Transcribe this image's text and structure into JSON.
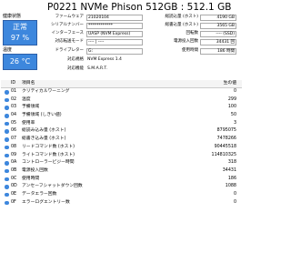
{
  "title": "P0221 NVMe Phison 512GB : 512.1 GB",
  "status": {
    "health_label": "健康状態",
    "health_value": "正常",
    "health_percent": "97 %",
    "temp_label": "温度",
    "temp_value": "26 °C"
  },
  "left_info": [
    {
      "label": "ファームウェア",
      "value": "21020104"
    },
    {
      "label": "シリアルナンバー",
      "value": "************"
    },
    {
      "label": "インターフェース",
      "value": "UASP (NVM Express)"
    },
    {
      "label": "対応転送モード",
      "value": "---- | ----"
    },
    {
      "label": "ドライブレター",
      "value": "G:"
    },
    {
      "label": "対応規格",
      "value": "NVM Express 1.4"
    },
    {
      "label": "対応機能",
      "value": "S.M.A.R.T."
    }
  ],
  "right_info": [
    {
      "label": "総読込量 (ホスト)",
      "value": "4190 GB"
    },
    {
      "label": "総書込量 (ホスト)",
      "value": "3565 GB"
    },
    {
      "label": "回転数",
      "value": "---- (SSD)"
    },
    {
      "label": "電源投入回数",
      "value": "34431 回"
    },
    {
      "label": "使用時間",
      "value": "186 時間"
    }
  ],
  "table": {
    "headers": {
      "id": "ID",
      "name": "項目名",
      "raw": "生の値"
    },
    "rows": [
      {
        "id": "01",
        "name": "クリティカルワーニング",
        "raw": "0"
      },
      {
        "id": "02",
        "name": "温度",
        "raw": "299"
      },
      {
        "id": "03",
        "name": "予備領域",
        "raw": "100"
      },
      {
        "id": "04",
        "name": "予備領域 (しきい値)",
        "raw": "50"
      },
      {
        "id": "05",
        "name": "使用率",
        "raw": "3"
      },
      {
        "id": "06",
        "name": "総読み込み量 (ホスト)",
        "raw": "8795075"
      },
      {
        "id": "07",
        "name": "総書き込み量 (ホスト)",
        "raw": "7478266"
      },
      {
        "id": "08",
        "name": "リードコマンド数 (ホスト)",
        "raw": "90445518"
      },
      {
        "id": "09",
        "name": "ライトコマンド数 (ホスト)",
        "raw": "114810325"
      },
      {
        "id": "0A",
        "name": "コントローラービジー時間",
        "raw": "318"
      },
      {
        "id": "0B",
        "name": "電源投入回数",
        "raw": "34431"
      },
      {
        "id": "0C",
        "name": "使用時間",
        "raw": "186"
      },
      {
        "id": "0D",
        "name": "アンセーフシャットダウン回数",
        "raw": "1088"
      },
      {
        "id": "0E",
        "name": "データエラー回数",
        "raw": "0"
      },
      {
        "id": "0F",
        "name": "エラーログエントリー数",
        "raw": "0"
      }
    ]
  }
}
